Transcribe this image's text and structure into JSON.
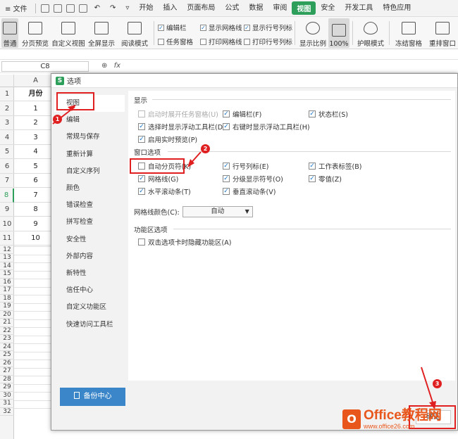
{
  "menu": {
    "file": "≡ 文件",
    "tabs": [
      "开始",
      "插入",
      "页面布局",
      "公式",
      "数据",
      "审阅",
      "视图",
      "安全",
      "开发工具",
      "特色应用"
    ],
    "active_tab_index": 6
  },
  "ribbon": {
    "buttons": [
      "普通",
      "分页预览",
      "自定义视图",
      "全屏显示",
      "阅读模式"
    ],
    "check_col1": [
      "编辑栏",
      "任务窗格"
    ],
    "check_col2": [
      "显示网格线",
      "打印网格线"
    ],
    "check_col3": [
      "显示行号列标",
      "打印行号列标"
    ],
    "zoom_buttons": [
      "显示比例",
      "100%"
    ],
    "eye_mode": "护眼模式",
    "freeze": "冻结窗格",
    "rearrange": "重排窗口"
  },
  "formula_bar": {
    "name_box": "C8",
    "fx": "fx"
  },
  "sheet": {
    "col_headers": [
      "A"
    ],
    "header_cell": "月份",
    "values": [
      "1",
      "2",
      "3",
      "4",
      "5",
      "6",
      "7",
      "8",
      "9",
      "10"
    ],
    "row_numbers": [
      "1",
      "2",
      "3",
      "4",
      "5",
      "6",
      "7",
      "8",
      "9",
      "10",
      "11",
      "12",
      "13",
      "14",
      "15",
      "16",
      "17",
      "18",
      "19",
      "20",
      "21",
      "22",
      "23",
      "24",
      "25",
      "26",
      "27",
      "28",
      "29",
      "30",
      "31",
      "32"
    ],
    "highlight_row": "8"
  },
  "dialog": {
    "title": "选项",
    "logo": "S",
    "nav": [
      "视图",
      "编辑",
      "常规与保存",
      "重新计算",
      "自定义序列",
      "颜色",
      "错误检查",
      "拼写检查",
      "安全性",
      "外部内容",
      "新特性",
      "信任中心",
      "自定义功能区",
      "快速访问工具栏"
    ],
    "selected_nav_index": 0,
    "backup_label": "备份中心",
    "display": {
      "title": "显示",
      "options": [
        {
          "label": "启动时展开任务窗格(U)",
          "checked": false,
          "disabled": true
        },
        {
          "label": "编辑栏(F)",
          "checked": true
        },
        {
          "label": "状态栏(S)",
          "checked": true
        },
        {
          "label": "选择时显示浮动工具栏(D)",
          "checked": true
        },
        {
          "label": "右键时显示浮动工具栏(H)",
          "checked": true
        },
        {
          "label": "启用实时预览(P)",
          "checked": true
        }
      ]
    },
    "window": {
      "title": "窗口选项",
      "options": [
        {
          "label": "自动分页符(K)",
          "checked": false
        },
        {
          "label": "行号列标(E)",
          "checked": true
        },
        {
          "label": "工作表标签(B)",
          "checked": true
        },
        {
          "label": "网格线(G)",
          "checked": true
        },
        {
          "label": "分级显示符号(O)",
          "checked": true
        },
        {
          "label": "零值(Z)",
          "checked": true
        },
        {
          "label": "水平滚动条(T)",
          "checked": true
        },
        {
          "label": "垂直滚动条(V)",
          "checked": true
        }
      ],
      "grid_color_label": "网格线颜色(C):",
      "grid_color_value": "自动"
    },
    "ribbon_opts": {
      "title": "功能区选项",
      "options": [
        {
          "label": "双击选项卡时隐藏功能区(A)",
          "checked": false
        }
      ]
    },
    "ok_label": "确定"
  },
  "annotations": {
    "badges": [
      "1",
      "2",
      "3"
    ],
    "color": "#e02020"
  },
  "watermark": {
    "brand": "Office教程网",
    "url": "www.office26.com"
  }
}
